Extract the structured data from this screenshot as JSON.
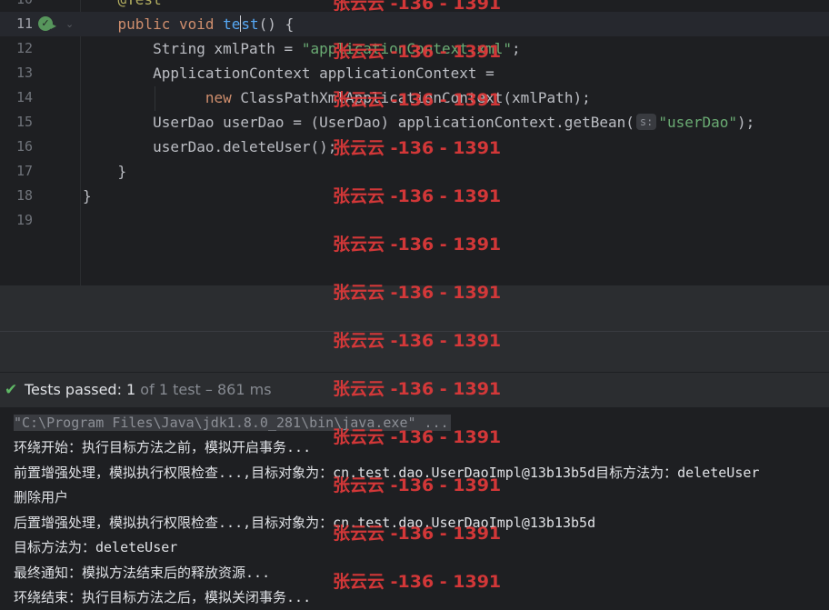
{
  "editor": {
    "lines": [
      {
        "number": "10",
        "tokens": [
          {
            "t": "    ",
            "c": ""
          },
          {
            "t": "@Test",
            "c": "ann"
          }
        ]
      },
      {
        "number": "11",
        "current": true,
        "tokens": [
          {
            "t": "    ",
            "c": ""
          },
          {
            "t": "public",
            "c": "kw"
          },
          {
            "t": " ",
            "c": ""
          },
          {
            "t": "void",
            "c": "kw"
          },
          {
            "t": " ",
            "c": ""
          },
          {
            "t": "te",
            "c": "fn"
          },
          {
            "t": "|caret|",
            "c": "caret"
          },
          {
            "t": "st",
            "c": "fn"
          },
          {
            "t": "() {",
            "c": ""
          }
        ]
      },
      {
        "number": "12",
        "tokens": [
          {
            "t": "        String xmlPath = ",
            "c": ""
          },
          {
            "t": "\"applicationContext.xml\"",
            "c": "str"
          },
          {
            "t": ";",
            "c": ""
          }
        ]
      },
      {
        "number": "13",
        "tokens": [
          {
            "t": "        ApplicationContext applicationContext =",
            "c": ""
          }
        ]
      },
      {
        "number": "14",
        "tokens": [
          {
            "t": "              ",
            "c": ""
          },
          {
            "t": "new",
            "c": "kw"
          },
          {
            "t": " ClassPathXmlApplicationContext(xmlPath);",
            "c": ""
          }
        ]
      },
      {
        "number": "15",
        "tokens": [
          {
            "t": "        UserDao userDao = (UserDao) applicationContext.getBean(",
            "c": ""
          },
          {
            "t": "s:",
            "c": "hint"
          },
          {
            "t": "\"userDao\"",
            "c": "str"
          },
          {
            "t": ");",
            "c": ""
          }
        ]
      },
      {
        "number": "16",
        "tokens": [
          {
            "t": "        userDao.deleteUser();",
            "c": ""
          }
        ]
      },
      {
        "number": "17",
        "tokens": [
          {
            "t": "    }",
            "c": ""
          }
        ]
      },
      {
        "number": "18",
        "tokens": [
          {
            "t": "}",
            "c": ""
          }
        ]
      },
      {
        "number": "19",
        "tokens": []
      }
    ]
  },
  "test_status": {
    "check_icon": "check-icon",
    "label": "Tests passed: 1",
    "detail": " of 1 test – 861 ms"
  },
  "console": {
    "command": "\"C:\\Program Files\\Java\\jdk1.8.0_281\\bin\\java.exe\" ...",
    "lines": [
      "环绕开始：执行目标方法之前，模拟开启事务...",
      "前置增强处理，模拟执行权限检查...,目标对象为：cn.test.dao.UserDaoImpl@13b13b5d目标方法为：deleteUser",
      "删除用户",
      "后置增强处理，模拟执行权限检查...,目标对象为：cn.test.dao.UserDaoImpl@13b13b5d",
      "目标方法为：deleteUser",
      "最终通知：模拟方法结束后的释放资源...",
      "环绕结束：执行目标方法之后，模拟关闭事务..."
    ]
  },
  "watermark": {
    "text": "张云云 -136 - 1391",
    "color": "#e23a3a"
  },
  "colors": {
    "editor_bg": "#1e1f22",
    "keyword": "#cf8e6d",
    "string": "#6aab73",
    "annotation": "#b3ae60",
    "method": "#56a8f5",
    "pass_green": "#5fb865"
  }
}
